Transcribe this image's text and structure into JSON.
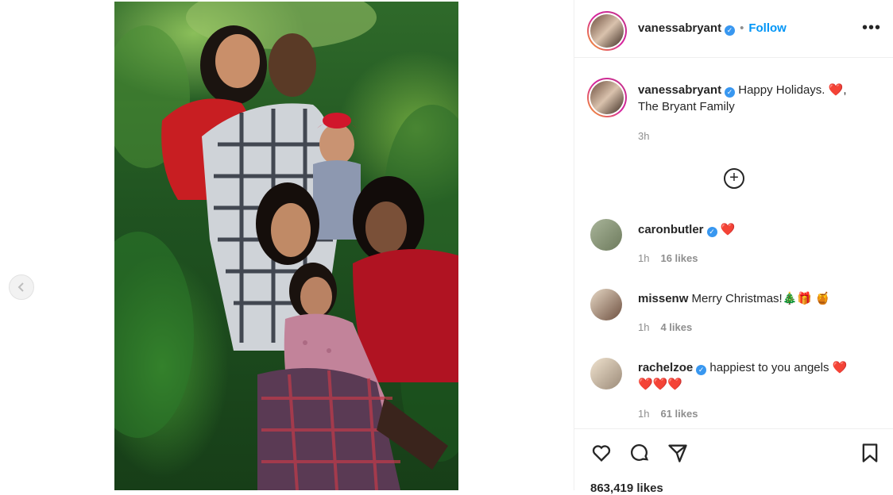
{
  "post": {
    "username": "vanessabryant",
    "verified_icon": "verified-badge-icon",
    "follow_label": "Follow",
    "separator": "•",
    "more_label": "•••"
  },
  "caption": {
    "username": "vanessabryant",
    "text": "Happy Holidays.",
    "heart": "❤️",
    "suffix": ",",
    "line2": "The Bryant Family",
    "time": "3h"
  },
  "load_more_label": "+",
  "comments": [
    {
      "username": "caronbutler",
      "verified": true,
      "text": "",
      "emoji": "❤️",
      "time": "1h",
      "likes": "16 likes"
    },
    {
      "username": "missenw",
      "verified": false,
      "text": "Merry Christmas!",
      "emoji": "🎄🎁 🍯",
      "time": "1h",
      "likes": "4 likes"
    },
    {
      "username": "rachelzoe",
      "verified": true,
      "text": "happiest to you angels",
      "emoji": "❤️",
      "emoji_line2": "❤️❤️❤️",
      "time": "1h",
      "likes": "61 likes"
    }
  ],
  "actions": {
    "like_icon": "heart-icon",
    "comment_icon": "comment-icon",
    "share_icon": "share-icon",
    "save_icon": "bookmark-icon",
    "likes_total": "863,419 likes"
  },
  "colors": {
    "follow": "#0095f6",
    "verified": "#3897f0",
    "heart": "#ed4956",
    "muted_text": "#8e8e8e"
  }
}
